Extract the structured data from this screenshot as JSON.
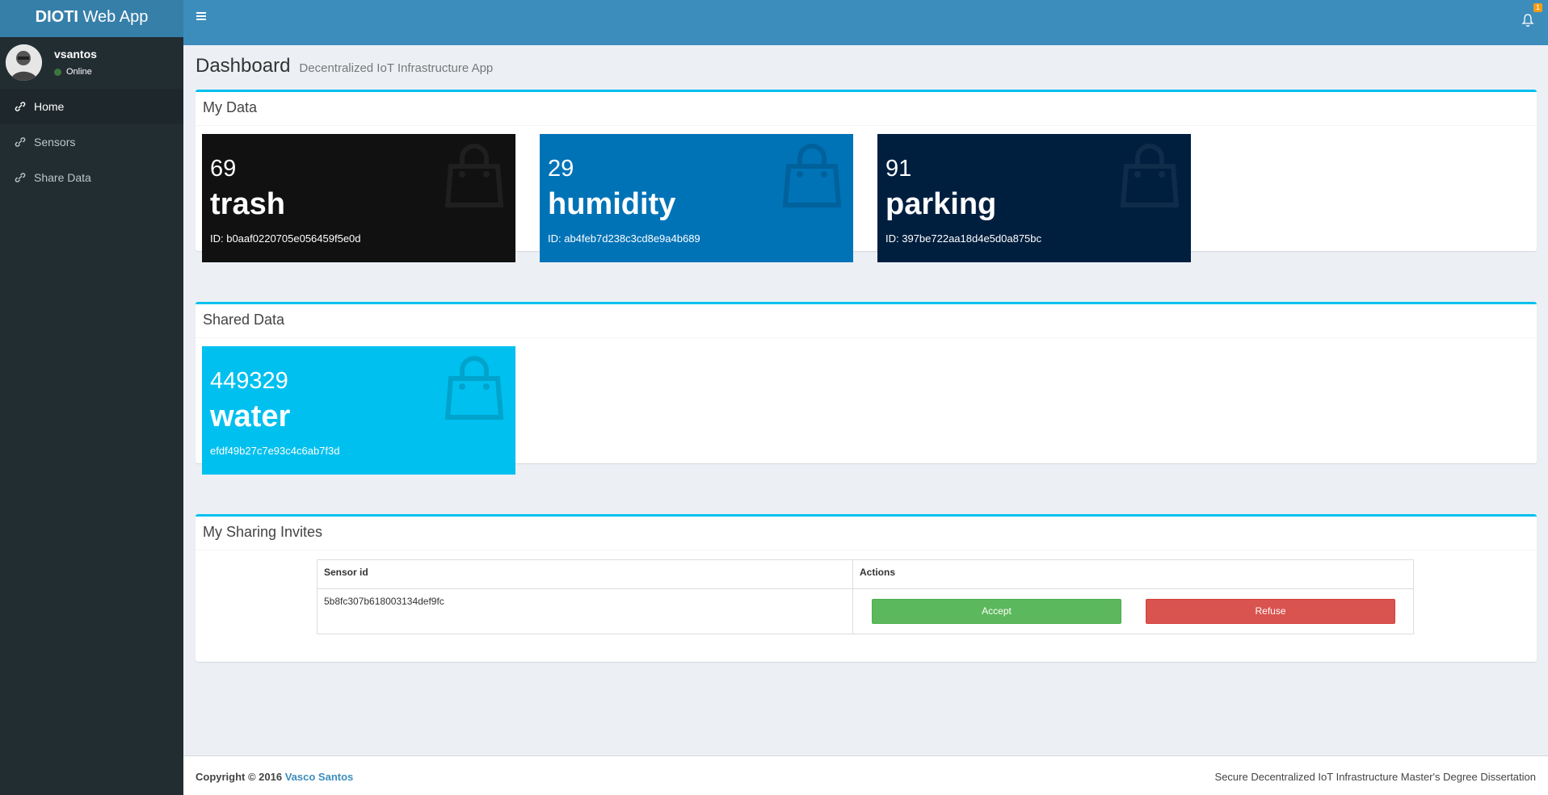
{
  "app": {
    "logo_bold": "DIOTI",
    "logo_rest": " Web App"
  },
  "user": {
    "name": "vsantos",
    "status": "Online"
  },
  "sidebar": {
    "items": [
      {
        "label": "Home",
        "icon": "link-icon"
      },
      {
        "label": "Sensors",
        "icon": "link-icon"
      },
      {
        "label": "Share Data",
        "icon": "link-icon"
      }
    ]
  },
  "header": {
    "notification_count": "1"
  },
  "page": {
    "title": "Dashboard",
    "subtitle": "Decentralized IoT Infrastructure App"
  },
  "my_data": {
    "title": "My Data",
    "tiles": [
      {
        "count": "69",
        "name": "trash",
        "id_line": "ID: b0aaf0220705e056459f5e0d",
        "color": "#111111"
      },
      {
        "count": "29",
        "name": "humidity",
        "id_line": "ID: ab4feb7d238c3cd8e9a4b689",
        "color": "#0073b7"
      },
      {
        "count": "91",
        "name": "parking",
        "id_line": "ID: 397be722aa18d4e5d0a875bc",
        "color": "#001f3f"
      }
    ]
  },
  "shared_data": {
    "title": "Shared Data",
    "tiles": [
      {
        "count": "449329",
        "name": "water",
        "id_line": "efdf49b27c7e93c4c6ab7f3d",
        "color": "#00c0ef"
      }
    ]
  },
  "invites": {
    "title": "My Sharing Invites",
    "columns": [
      "Sensor id",
      "Actions"
    ],
    "rows": [
      {
        "sensor_id": "5b8fc307b618003134def9fc",
        "accept": "Accept",
        "refuse": "Refuse"
      }
    ]
  },
  "footer": {
    "copyright": "Copyright © 2016 ",
    "author": "Vasco Santos",
    "right": "Secure Decentralized IoT Infrastructure Master's Degree Dissertation"
  }
}
